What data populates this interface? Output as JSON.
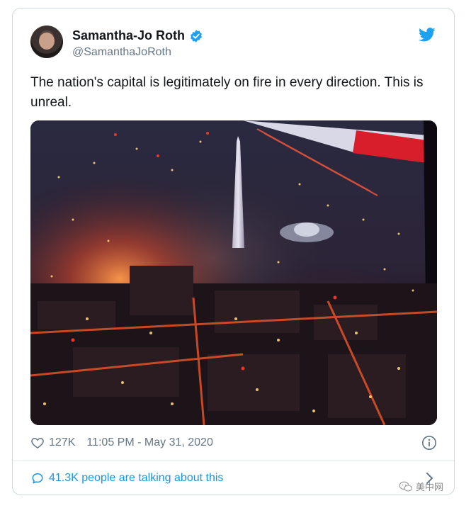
{
  "tweet": {
    "author": {
      "display_name": "Samantha-Jo Roth",
      "handle": "@SamanthaJoRoth",
      "verified": true
    },
    "text": "The nation's capital is legitimately on fire in every direction. This is unreal.",
    "likes": "127K",
    "timestamp": "11:05 PM - May 31, 2020",
    "conversation": "41.3K people are talking about this"
  },
  "icons": {
    "verified": "verified-badge-icon",
    "brand": "twitter-bird-icon",
    "like": "heart-icon",
    "info": "info-icon",
    "reply": "speech-bubble-icon",
    "more": "chevron-right-icon"
  },
  "watermark": {
    "label": "美中网"
  },
  "colors": {
    "twitter_blue": "#1da1f2",
    "link_blue": "#1b95e0",
    "secondary_text": "#657786",
    "border": "#cfd9de"
  }
}
